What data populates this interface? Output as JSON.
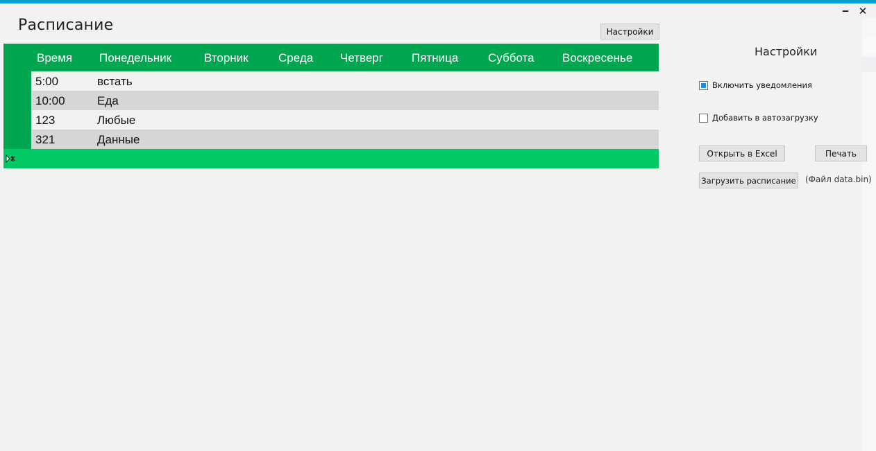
{
  "window": {
    "minimize_glyph": "‒",
    "close_glyph": "✕"
  },
  "page": {
    "title": "Расписание",
    "settings_button": "Настройки"
  },
  "schedule": {
    "columns": [
      "Время",
      "Понедельник",
      "Вторник",
      "Среда",
      "Четверг",
      "Пятница",
      "Суббота",
      "Воскресенье"
    ],
    "rows": [
      {
        "time": "5:00",
        "monday": "встать"
      },
      {
        "time": "10:00",
        "monday": "Еда"
      },
      {
        "time": "123",
        "monday": "Любые"
      },
      {
        "time": "321",
        "monday": "Данные"
      }
    ],
    "new_row_icon": "new-row-marker-icon"
  },
  "settings_panel": {
    "title": "Настройки",
    "notifications": {
      "label": "Включить уведомления",
      "checked": true
    },
    "autostart": {
      "label": "Добавить в автозагрузку",
      "checked": false
    },
    "open_excel": "Открыть в Excel",
    "print": "Печать",
    "load_schedule": "Загрузить расписание",
    "file_note": "(Файл data.bin)"
  },
  "colors": {
    "accent_bar": "#0aa0d0",
    "grid_header": "#00a650",
    "grid_new_row": "#00c864",
    "row_alt": "#d6d6d6",
    "checkbox_fill": "#1f8dd6"
  }
}
